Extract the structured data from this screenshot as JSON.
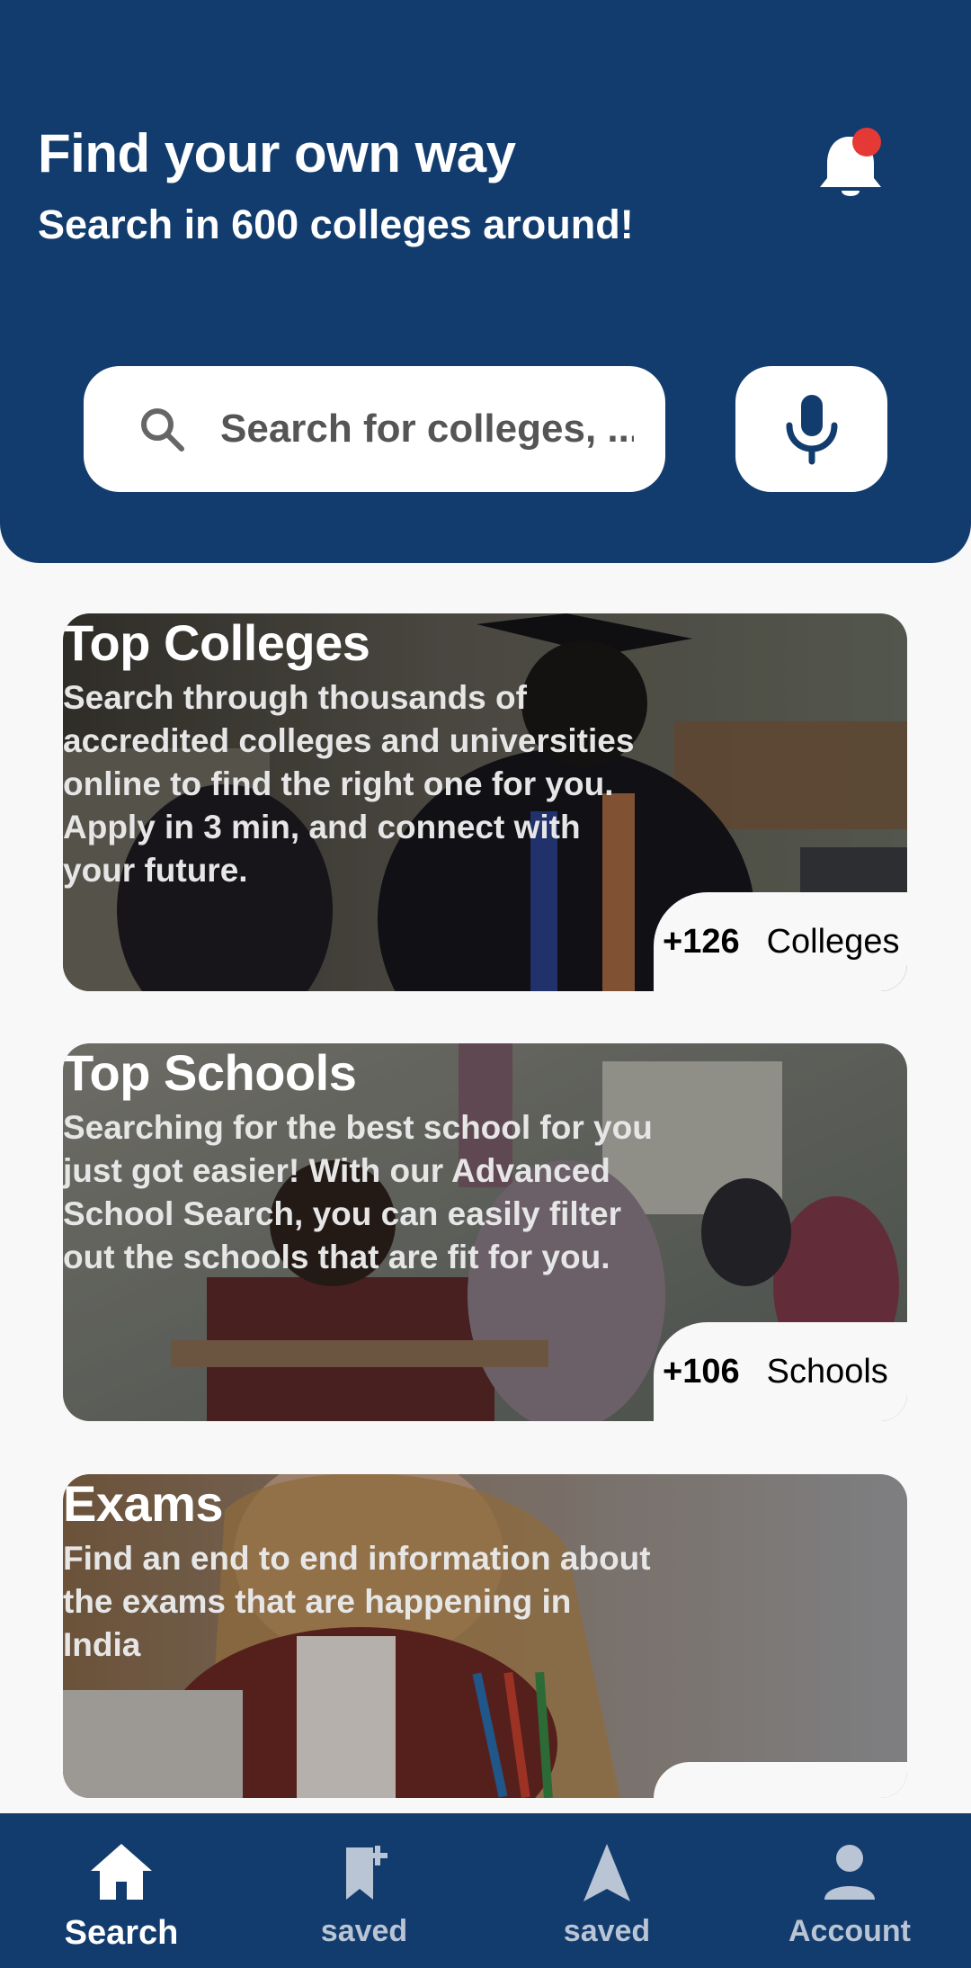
{
  "header": {
    "title": "Find your own way",
    "subtitle": "Search in 600 colleges around!",
    "notification_icon": "bell-icon",
    "search_placeholder": "Search for colleges, ...",
    "mic_icon": "mic-icon"
  },
  "cards": [
    {
      "title": "Top Colleges",
      "description": "Search through thousands of accredited colleges and universities online to find the right one for you. Apply in 3 min, and connect with your future.",
      "count": "+126",
      "count_label": "Colleges"
    },
    {
      "title": "Top Schools",
      "description": "Searching for the best school for you just got easier! With our Advanced School Search, you can easily filter out the schools that are fit for you.",
      "count": "+106",
      "count_label": "Schools"
    },
    {
      "title": "Exams",
      "description": "Find an end to end information about the exams that are happening in India"
    }
  ],
  "nav": [
    {
      "label": "Search",
      "icon": "home-icon",
      "active": true
    },
    {
      "label": "saved",
      "icon": "bookmark-add-icon",
      "active": false
    },
    {
      "label": "saved",
      "icon": "navigation-arrow-icon",
      "active": false
    },
    {
      "label": "Account",
      "icon": "person-icon",
      "active": false
    }
  ],
  "colors": {
    "primary": "#123c6e",
    "notification_dot": "#e53935",
    "background": "#f8f8f8"
  }
}
